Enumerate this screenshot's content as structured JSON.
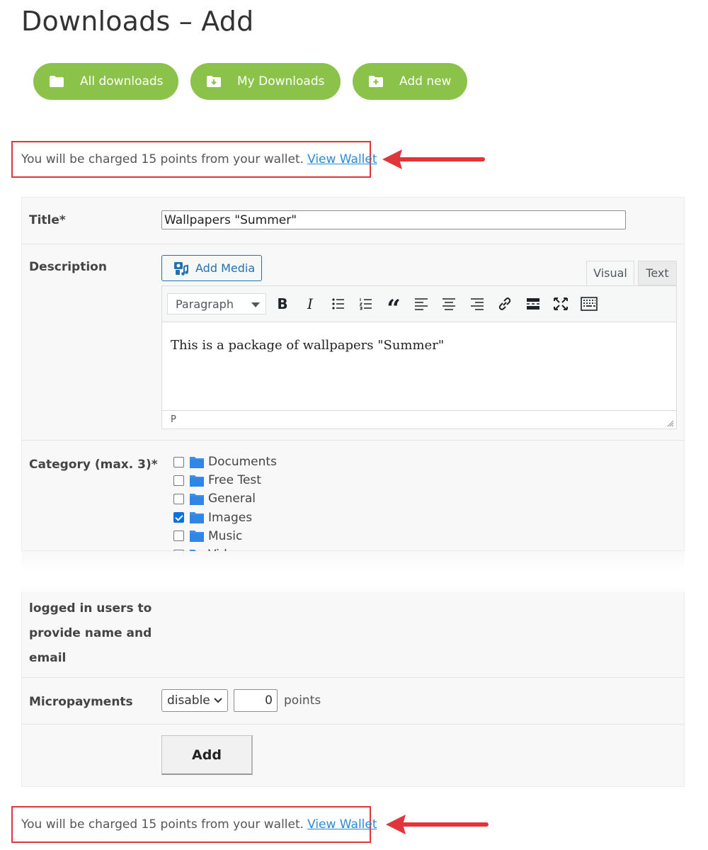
{
  "page": {
    "title": "Downloads – Add"
  },
  "nav_buttons": [
    {
      "label": "All downloads",
      "icon": "folder-icon"
    },
    {
      "label": "My Downloads",
      "icon": "folder-download-icon"
    },
    {
      "label": "Add new",
      "icon": "folder-add-icon"
    }
  ],
  "notice": {
    "text": "You will be charged 15 points from your wallet.",
    "link": "View Wallet"
  },
  "form": {
    "title": {
      "label": "Title*",
      "value": "Wallpapers \"Summer\""
    },
    "description": {
      "label": "Description",
      "add_media": "Add Media",
      "tabs": [
        "Visual",
        "Text"
      ],
      "active_tab": "Visual",
      "format": "Paragraph",
      "toolbar_icons": [
        "bold-icon",
        "italic-icon",
        "bullet-list-icon",
        "numbered-list-icon",
        "blockquote-icon",
        "align-left-icon",
        "align-center-icon",
        "align-right-icon",
        "link-icon",
        "read-more-icon",
        "fullscreen-icon",
        "toolbar-toggle-icon"
      ],
      "bold_glyph": "B",
      "italic_glyph": "I",
      "quote_glyph": "“",
      "content": "This is a package of wallpapers \"Summer\"",
      "status_path": "P"
    },
    "category": {
      "label": "Category (max. 3)*",
      "items": [
        {
          "name": "Documents",
          "checked": false
        },
        {
          "name": "Free Test",
          "checked": false
        },
        {
          "name": "General",
          "checked": false
        },
        {
          "name": "Images",
          "checked": true
        },
        {
          "name": "Music",
          "checked": false
        },
        {
          "name": "Videos",
          "checked": false
        }
      ]
    },
    "guest_option": {
      "label_lines": [
        "logged in users to",
        "provide name and",
        "email"
      ]
    },
    "micropayments": {
      "label": "Micropayments",
      "mode": "disable",
      "points_value": "0",
      "points_label": "points"
    },
    "submit": "Add"
  },
  "colors": {
    "button_green": "#8bc34a",
    "highlight_red": "#e0353b",
    "link_blue": "#2a8ad6",
    "folder_blue": "#3b8fe8"
  }
}
